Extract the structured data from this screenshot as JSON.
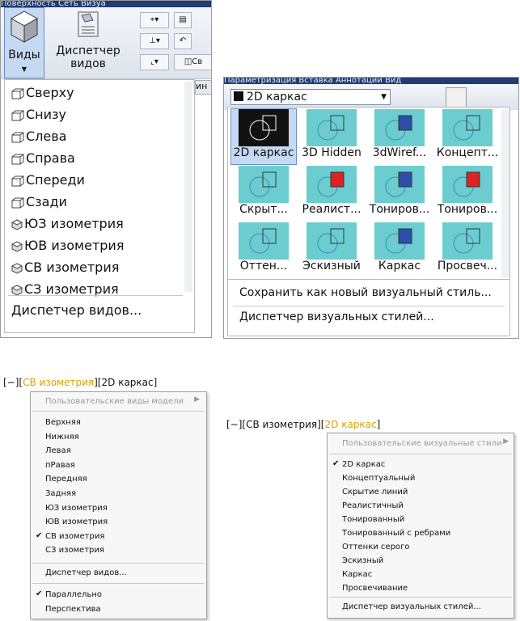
{
  "views_panel": {
    "top_partial_text": "Поверхность Сеть Визуа",
    "views_button_label": "Виды",
    "view_manager_button_label": "Диспетчер видов",
    "ribbon_tab_partial": "Св",
    "tab_partial": "ин",
    "menu_items": [
      "Сверху",
      "Снизу",
      "Слева",
      "Справа",
      "Спереди",
      "Сзади",
      "ЮЗ изометрия",
      "ЮВ изометрия",
      "СВ изометрия",
      "СЗ изометрия"
    ],
    "footer_item": "Диспетчер видов..."
  },
  "styles_panel": {
    "top_partial_text": "Параметризация  Вставка  Аннотации  Вид",
    "combo_value": "2D каркас",
    "tiles": [
      "2D каркас",
      "3D Hidden",
      "3dWiref...",
      "Концепт...",
      "Скрыт...",
      "Реалист...",
      "Тониров...",
      "Тониров...",
      "Оттен...",
      "Эскизный",
      "Каркас",
      "Просвеч..."
    ],
    "save_item": "Сохранить как новый визуальный стиль...",
    "manager_item": "Диспетчер визуальных стилей..."
  },
  "views_context": {
    "label_prefix": "[−][",
    "label_view": "СВ изометрия",
    "label_mid": "][",
    "label_style": "2D каркас",
    "label_suffix": "]",
    "header": "Пользовательские виды модели",
    "items": [
      "Верхняя",
      "Нижняя",
      "Левая",
      "пРавая",
      "Передняя",
      "Задняя",
      "ЮЗ изометрия",
      "ЮВ изометрия",
      "СВ изометрия",
      "СЗ изометрия"
    ],
    "checked_item": "СВ изометрия",
    "manager": "Диспетчер видов...",
    "projection": [
      "Параллельно",
      "Перспектива"
    ],
    "checked_projection": "Параллельно"
  },
  "styles_context": {
    "label_prefix": "[−][",
    "label_view": "СВ изометрия",
    "label_mid": "][",
    "label_style": "2D каркас",
    "label_suffix": "]",
    "header": "Пользовательские визуальные стили",
    "items": [
      "2D каркас",
      "Концептуальный",
      "Скрытие линий",
      "Реалистичный",
      "Тонированный",
      "Тонированный с ребрами",
      "Оттенки серого",
      "Эскизный",
      "Каркас",
      "Просвечивание"
    ],
    "checked_item": "2D каркас",
    "manager": "Диспетчер визуальных стилей..."
  },
  "colors": {
    "highlight": "#d9a400",
    "tile_bg": "#6ccdd0",
    "title_bar": "#1f3d73"
  }
}
